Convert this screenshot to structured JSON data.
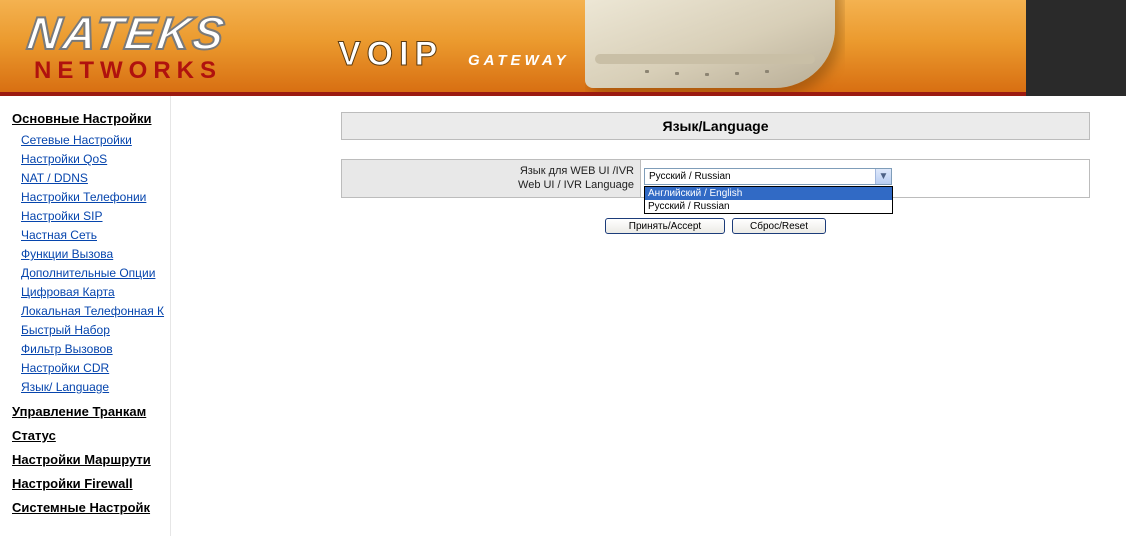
{
  "header": {
    "logo_top": "NATEKS",
    "logo_bottom": "NETWORKS",
    "product": "VOIP",
    "product_sub": "GATEWAY",
    "colors": {
      "orange": "#eb9a2e",
      "dark": "#2a2a2a",
      "logo_red": "#b0120e"
    }
  },
  "sidebar": {
    "main_section": "Основные Настройки",
    "items": [
      {
        "label": "Сетевые Настройки"
      },
      {
        "label": "Настройки QoS"
      },
      {
        "label": "NAT / DDNS"
      },
      {
        "label": "Настройки Телефонии"
      },
      {
        "label": "Настройки SIP"
      },
      {
        "label": "Частная Сеть"
      },
      {
        "label": "Функции Вызова"
      },
      {
        "label": "Дополнительные Опции"
      },
      {
        "label": "Цифровая Карта"
      },
      {
        "label": "Локальная Телефонная К"
      },
      {
        "label": "Быстрый Набор"
      },
      {
        "label": "Фильтр Вызовов"
      },
      {
        "label": "Настройки CDR"
      },
      {
        "label": "Язык/ Language"
      }
    ],
    "sections": [
      {
        "label": "Управление Транкам"
      },
      {
        "label": "Статус"
      },
      {
        "label": "Настройки Маршрути"
      },
      {
        "label": "Настройки Firewall"
      },
      {
        "label": "Системные Настройк"
      }
    ],
    "link_color": "#0645ad"
  },
  "main": {
    "title": "Язык/Language",
    "field_label_line1": "Язык для WEB UI /IVR",
    "field_label_line2": "Web UI / IVR Language",
    "select_value": "Русский / Russian",
    "options": [
      {
        "label": "Английский / English",
        "highlighted": true
      },
      {
        "label": "Русский / Russian",
        "highlighted": false
      }
    ],
    "accept_label": "Принять/Accept",
    "reset_label": "Сброс/Reset",
    "highlight_color": "#316ac5"
  }
}
